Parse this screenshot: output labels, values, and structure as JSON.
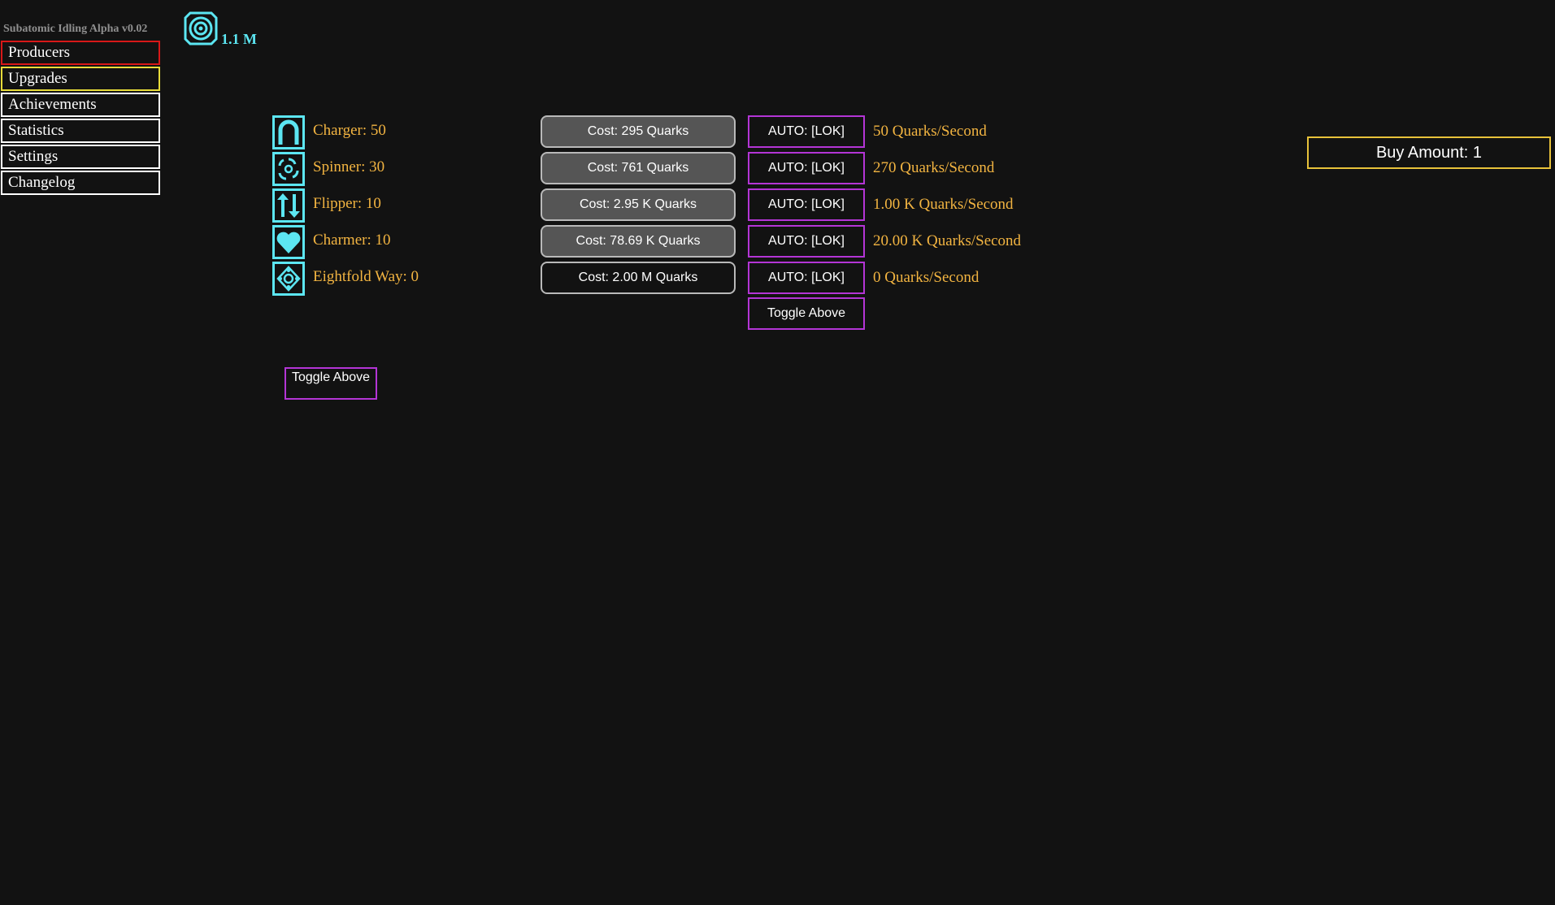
{
  "app": {
    "title": "Subatomic Idling Alpha v0.02"
  },
  "nav": {
    "items": [
      {
        "label": "Producers",
        "state": "active"
      },
      {
        "label": "Upgrades",
        "state": "highlighted"
      },
      {
        "label": "Achievements"
      },
      {
        "label": "Statistics"
      },
      {
        "label": "Settings"
      },
      {
        "label": "Changelog"
      }
    ]
  },
  "currency": {
    "icon": "quark-icon",
    "value": "1.1 M"
  },
  "producers": [
    {
      "name": "Charger: 50",
      "icon": "charger-icon",
      "cost": "Cost: 295 Quarks",
      "auto": "AUTO: [LOK]",
      "rate": "50 Quarks/Second",
      "affordable": true
    },
    {
      "name": "Spinner: 30",
      "icon": "spinner-icon",
      "cost": "Cost: 761 Quarks",
      "auto": "AUTO: [LOK]",
      "rate": "270 Quarks/Second",
      "affordable": true
    },
    {
      "name": "Flipper: 10",
      "icon": "flipper-icon",
      "cost": "Cost: 2.95 K Quarks",
      "auto": "AUTO: [LOK]",
      "rate": "1.00 K Quarks/Second",
      "affordable": true
    },
    {
      "name": "Charmer: 10",
      "icon": "charmer-icon",
      "cost": "Cost: 78.69 K Quarks",
      "auto": "AUTO: [LOK]",
      "rate": "20.00 K Quarks/Second",
      "affordable": true
    },
    {
      "name": "Eightfold Way: 0",
      "icon": "eightfold-way-icon",
      "cost": "Cost: 2.00 M Quarks",
      "auto": "AUTO: [LOK]",
      "rate": "0 Quarks/Second",
      "affordable": false
    }
  ],
  "auto_toggle_label": "Toggle Above",
  "secondary_toggle_label": "Toggle Above",
  "buy_amount_label": "Buy Amount: 1",
  "colors": {
    "background": "#121212",
    "cyan": "#5ce6f2",
    "gold": "#f2b441",
    "purple": "#b435d6",
    "red": "#d81818",
    "yellow": "#e8dc3a"
  }
}
